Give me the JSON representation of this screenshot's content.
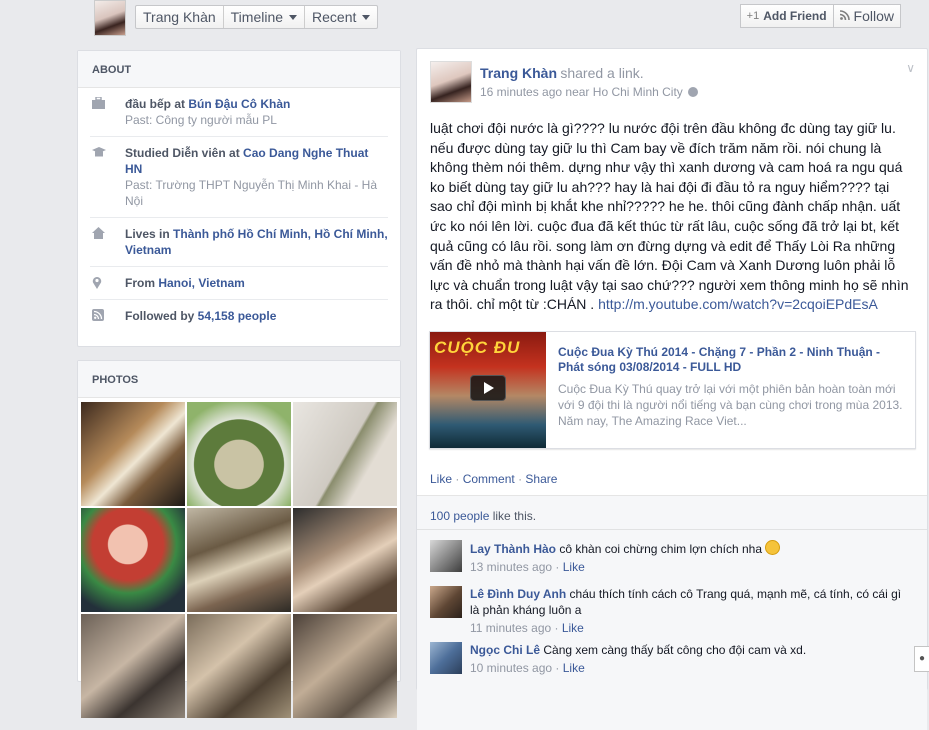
{
  "topbar": {
    "name": "Trang Khàn",
    "timeline": "Timeline",
    "recent": "Recent",
    "add_friend": "Add Friend",
    "follow": "Follow",
    "add_friend_icon": "+1",
    "follow_icon": "rss-icon"
  },
  "about": {
    "title": "ABOUT",
    "items": [
      {
        "icon": "briefcase-icon",
        "prefix": "đầu bếp at ",
        "link": "Bún Đậu Cô Khàn",
        "sub": "Past: Công ty người mẫu PL"
      },
      {
        "icon": "graduation-icon",
        "prefix": "Studied Diễn viên at ",
        "link": "Cao Dang Nghe Thuat HN",
        "sub": "Past: Trường THPT Nguyễn Thị Minh Khai - Hà Nội"
      },
      {
        "icon": "home-icon",
        "prefix": "Lives in ",
        "link": "Thành phố Hồ Chí Minh, Hồ Chí Minh, Vietnam",
        "sub": ""
      },
      {
        "icon": "location-pin-icon",
        "prefix": "From ",
        "link": "Hanoi, Vietnam",
        "sub": ""
      },
      {
        "icon": "rss-icon",
        "prefix": "Followed by ",
        "link": "54,158 people",
        "sub": ""
      }
    ]
  },
  "photos": {
    "title": "PHOTOS"
  },
  "post": {
    "author": "Trang Khàn",
    "action": "shared a link.",
    "time": "16 minutes ago",
    "near": "near",
    "location": "Ho Chi Minh City",
    "text": "luật chơi đội nước là gì???? lu nước đội trên đầu không đc dùng tay giữ lu. nếu được dùng tay giữ lu thì Cam bay về đích trăm năm rồi. nói chung là không thèm nói thêm. dựng như vậy thì xanh dương và cam hoá ra ngu quá ko biết dùng tay giữ lu ah??? hay là hai đội đi đầu tỏ ra nguy hiểm???? tại sao chỉ đội mình bị khắt khe nhỉ????? he he. thôi cũng đành chấp nhận. uất ức ko nói lên lời. cuộc đua đã kết thúc từ rất lâu, cuộc sống đã trở lại bt, kết quả cũng có lâu rồi. song làm ơn đừng dựng và edit để Thấy Lòi Ra những vấn đề nhỏ mà thành hại vấn đề lớn. Đội Cam và Xanh Dương luôn phải lỗ lực và chuẩn trong luật vậy tại sao chứ??? người xem thông minh họ sẽ nhìn ra thôi. chỉ một từ :CHÁN .",
    "url": "http://m.youtube.com/watch?v=2cqoiEPdEsA",
    "share": {
      "thumb_text": "CUỘC ĐU",
      "title": "Cuộc Đua Kỳ Thú 2014 - Chặng 7 - Phần 2 - Ninh Thuận - Phát sóng 03/08/2014 - FULL HD",
      "desc": "Cuộc Đua Kỳ Thú quay trở lại với một phiên bản hoàn toàn mới với 9 đội thi là người nổi tiếng và bạn cùng chơi trong mùa 2013. Năm nay, The Amazing Race Viet..."
    },
    "actions": {
      "like": "Like",
      "comment": "Comment",
      "share": "Share",
      "sep": "·"
    },
    "likes": {
      "count": "100 people",
      "suffix": " like this."
    },
    "comments": [
      {
        "name": "Lay Thành Hào",
        "text": " cô khàn coi chừng chim lợn chích nha ",
        "time": "13 minutes ago",
        "like": "Like",
        "emoji": true
      },
      {
        "name": "Lê Đình Duy Anh",
        "text": " cháu thích tính cách cô Trang quá, mạnh mẽ, cá tính, có cái gì là phản kháng luôn a",
        "time": "11 minutes ago",
        "like": "Like",
        "emoji": false
      },
      {
        "name": "Ngọc Chi Lê",
        "text": " Càng xem càng thấy bất công cho đội cam và xd.",
        "time": "10 minutes ago",
        "like": "Like",
        "emoji": false
      }
    ]
  }
}
